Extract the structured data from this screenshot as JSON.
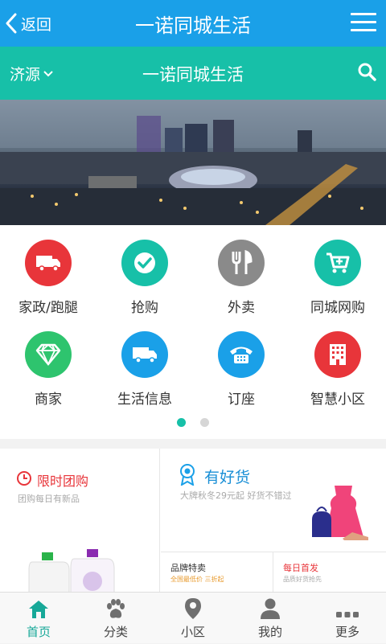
{
  "header": {
    "back_label": "返回",
    "title": "一诺同城生活"
  },
  "subheader": {
    "city": "济源",
    "title": "一诺同城生活"
  },
  "banner": {
    "icon": "city-night-photo"
  },
  "services": [
    {
      "label": "家政/跑腿",
      "icon": "truck-icon",
      "color": "#e8353a"
    },
    {
      "label": "抢购",
      "icon": "checkmark-icon",
      "color": "#17c0a8"
    },
    {
      "label": "外卖",
      "icon": "fork-knife-icon",
      "color": "#8a8a8a"
    },
    {
      "label": "同城网购",
      "icon": "cart-icon",
      "color": "#17c0a8"
    },
    {
      "label": "商家",
      "icon": "diamond-icon",
      "color": "#2ec46e"
    },
    {
      "label": "生活信息",
      "icon": "truck-icon",
      "color": "#1aa0e8"
    },
    {
      "label": "订座",
      "icon": "telephone-icon",
      "color": "#1aa0e8"
    },
    {
      "label": "智慧小区",
      "icon": "building-icon",
      "color": "#e8353a"
    }
  ],
  "pager": {
    "pages": 2,
    "active": 1
  },
  "promo": {
    "flash": {
      "title": "限时团购",
      "subtitle": "团购每日有新品"
    },
    "goods": {
      "title": "有好货",
      "subtitle": "大牌秋冬29元起 好货不错过"
    },
    "brand": {
      "title": "品牌特卖",
      "subtitle": "全国最低价 三折起"
    },
    "first": {
      "title": "每日首发",
      "subtitle": "品质好货抢先"
    }
  },
  "tabs": [
    {
      "label": "首页",
      "icon": "home-icon"
    },
    {
      "label": "分类",
      "icon": "paw-icon"
    },
    {
      "label": "小区",
      "icon": "location-pin-icon"
    },
    {
      "label": "我的",
      "icon": "user-icon"
    },
    {
      "label": "更多",
      "icon": "more-dots-icon"
    }
  ],
  "colors": {
    "header": "#1aa0e8",
    "teal": "#17c0a8",
    "red": "#e8353a"
  }
}
